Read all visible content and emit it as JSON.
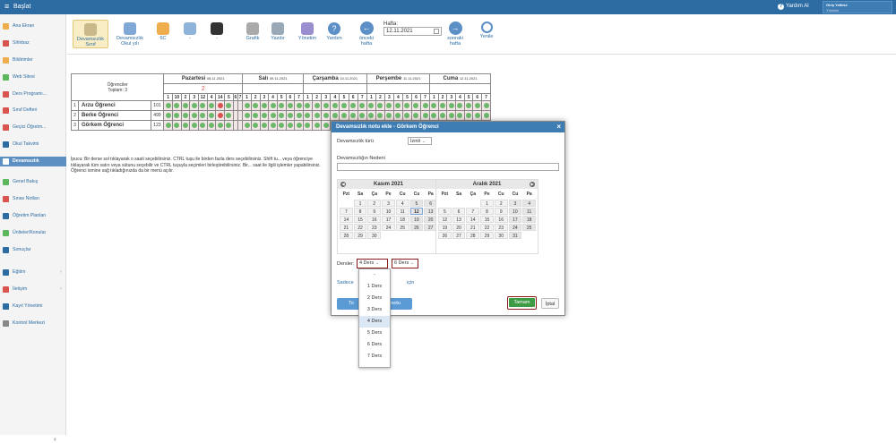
{
  "topbar": {
    "title": "Başlat",
    "help": "Yardım Al",
    "auth_label": "Giriş Yetkisi:",
    "auth_value": "Yönetici"
  },
  "sidebar": {
    "items": [
      {
        "label": "Ana Ekran",
        "icon": "star-icon",
        "color": "#f0ad4e"
      },
      {
        "label": "Sihirbaz",
        "icon": "wand-icon",
        "color": "#d9534f"
      },
      {
        "label": "Bildirimler",
        "icon": "mail-icon",
        "color": "#f0ad4e"
      },
      {
        "label": "Web Sitesi",
        "icon": "home-icon",
        "color": "#5cb85c"
      },
      {
        "label": "Ders Programı...",
        "icon": "table-icon",
        "color": "#d9534f"
      },
      {
        "label": "Sınıf Defteri",
        "icon": "book-icon",
        "color": "#d9534f"
      },
      {
        "label": "Geçici Öğretm...",
        "icon": "user-icon",
        "color": "#d9534f"
      },
      {
        "label": "Okul Takvimi",
        "icon": "calendar-icon",
        "color": "#2d6ca2"
      },
      {
        "label": "Devamsızlık",
        "icon": "checklist-icon",
        "color": "#5d8fc2",
        "active": true
      },
      {
        "label": "Genel Bakış",
        "icon": "circle-icon",
        "color": "#5cb85c"
      },
      {
        "label": "Sınav Notları",
        "icon": "circle-icon",
        "color": "#d9534f"
      },
      {
        "label": "Öğretim Planları",
        "icon": "list-icon",
        "color": "#2d6ca2"
      },
      {
        "label": "Üniteler/Konular",
        "icon": "shield-icon",
        "color": "#5cb85c"
      },
      {
        "label": "Sonuçlar",
        "icon": "chart-icon",
        "color": "#2d6ca2"
      },
      {
        "label": "Eğitim",
        "icon": "grid-icon",
        "color": "#2d6ca2",
        "arrow": "›"
      },
      {
        "label": "İletişim",
        "icon": "chat-icon",
        "color": "#d9534f",
        "arrow": "›"
      },
      {
        "label": "Kayıt Yönetimi",
        "icon": "pen-icon",
        "color": "#2d6ca2"
      },
      {
        "label": "Kontrol Merkezi",
        "icon": "gear-icon",
        "color": "#888"
      }
    ],
    "collapse": "‹"
  },
  "toolbar": {
    "devamsizlik_sinif": "Devamsızlık Sınıf",
    "devamsizlik_okul": "Devamsızlık Okul yılı",
    "class": "6C",
    "dash1": "-",
    "dash2": "-",
    "grafik": "Grafik",
    "yazdir": "Yazdır",
    "yonetim": "Yönetim",
    "yardim": "Yardım",
    "onceki": "önceki hafta",
    "hafta_label": "Hafta:",
    "hafta_value": "12.11.2021",
    "sonraki": "sonraki hafta",
    "yenile": "Yenile"
  },
  "grid": {
    "students_label": "Öğrenciler",
    "total_label": "Toplam: 3",
    "red_count": "2",
    "days": [
      {
        "name": "Pazartesi",
        "date": "08.11.2021"
      },
      {
        "name": "Salı",
        "date": "09.11.2021"
      },
      {
        "name": "Çarşamba",
        "date": "10.11.2021"
      },
      {
        "name": "Perşembe",
        "date": "11.11.2021"
      },
      {
        "name": "Cuma",
        "date": "12.11.2021"
      }
    ],
    "mon_hours": [
      "1",
      "10",
      "2",
      "3",
      "12",
      "4",
      "14",
      "5",
      "6",
      "7"
    ],
    "hours": [
      "1",
      "2",
      "3",
      "4",
      "5",
      "6",
      "7"
    ],
    "students": [
      {
        "no": "1",
        "name": "Arzu Öğrenci",
        "id": "101"
      },
      {
        "no": "2",
        "name": "Berke Öğrenci",
        "id": "499"
      },
      {
        "no": "3",
        "name": "Görkem Öğrenci",
        "id": "123"
      }
    ]
  },
  "info": "İpucu: Bir derse sol tıklayarak o saati seçebilirsiniz. CTRL tuşu ile birden fazla ders seçebilirsiniz. Shift tu... veya öğrenciye tıklayarak tüm satırı veya sütunu seçebilir ve CTRL tuşuyla seçimleri birleştirebilirsiniz. Bir... saat ile ilgili işlemler yapabilirsiniz. Öğrenci ismine sağ tıkladığınızda da bir menü açılır.",
  "modal": {
    "title": "Devamsızlık notu ekle - Görkem Öğrenci",
    "close": "×",
    "type_label": "Devamsızlık türü",
    "type_value": "İzinli",
    "reason_label": "Devamsızlığın Nedeni",
    "kasim": {
      "title": "Kasım 2021",
      "days": [
        "",
        "1",
        "2",
        "3",
        "4",
        "5",
        "6",
        "7",
        "8",
        "9",
        "10",
        "11",
        "12",
        "13",
        "14",
        "15",
        "16",
        "17",
        "18",
        "19",
        "20",
        "21",
        "22",
        "23",
        "24",
        "25",
        "26",
        "27",
        "28",
        "29",
        "30"
      ]
    },
    "aralik": {
      "title": "Aralık 2021",
      "days": [
        "",
        "",
        "",
        "1",
        "2",
        "3",
        "4",
        "5",
        "6",
        "7",
        "8",
        "9",
        "10",
        "11",
        "12",
        "13",
        "14",
        "15",
        "16",
        "17",
        "18",
        "19",
        "20",
        "21",
        "22",
        "23",
        "24",
        "25",
        "26",
        "27",
        "28",
        "29",
        "30",
        "31"
      ]
    },
    "weekdays": [
      "Pzt",
      "Sa",
      "Ça",
      "Pe",
      "Cu",
      "Cu",
      "Pa"
    ],
    "dersler_label": "Dersler:",
    "from_value": "4 Ders",
    "to_value": "6 Ders",
    "sadece": "Sadece",
    "icin": "için",
    "btn_left": "To",
    "btn_left2": "notu",
    "ok": "Tamam",
    "cancel": "İptal"
  },
  "dropdown": {
    "options": [
      "-",
      "1 Ders",
      "2 Ders",
      "3 Ders",
      "4 Ders",
      "5 Ders",
      "6 Ders",
      "7 Ders"
    ],
    "selected": "4 Ders"
  }
}
